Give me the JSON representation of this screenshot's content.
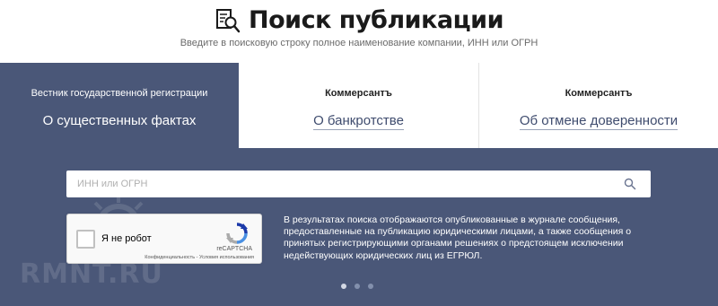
{
  "header": {
    "title": "Поиск публикации",
    "subtitle": "Введите в поисковую строку полное наименование компании, ИНН или ОГРН",
    "icon": "search-document-icon"
  },
  "tabs": [
    {
      "source": "Вестник государственной регистрации",
      "topic": "О существенных фактах",
      "active": true
    },
    {
      "source": "Коммерсантъ",
      "topic": "О банкротстве",
      "active": false
    },
    {
      "source": "Коммерсантъ",
      "topic": "Об отмене доверенности",
      "active": false
    }
  ],
  "search": {
    "placeholder": "ИНН или ОГРН",
    "value": "",
    "icon": "search-icon"
  },
  "captcha": {
    "label": "Я не робот",
    "brand": "reCAPTCHA",
    "links": "Конфиденциальность - Условия использования",
    "checked": false
  },
  "description": "В результатах поиска отображаются опубликованные в журнале сообщения, предоставленные на публикацию юридическими лицами, а также сообщения о принятых регистрирующими органами решениях о предстоящем исключении недействующих юридических лиц из ЕГРЮЛ.",
  "pagination": {
    "count": 3,
    "active_index": 0
  },
  "watermark": "RMNT.RU",
  "colors": {
    "panel": "#4a5778",
    "accent_text": "#3f4c6e",
    "background": "#ffffff"
  }
}
